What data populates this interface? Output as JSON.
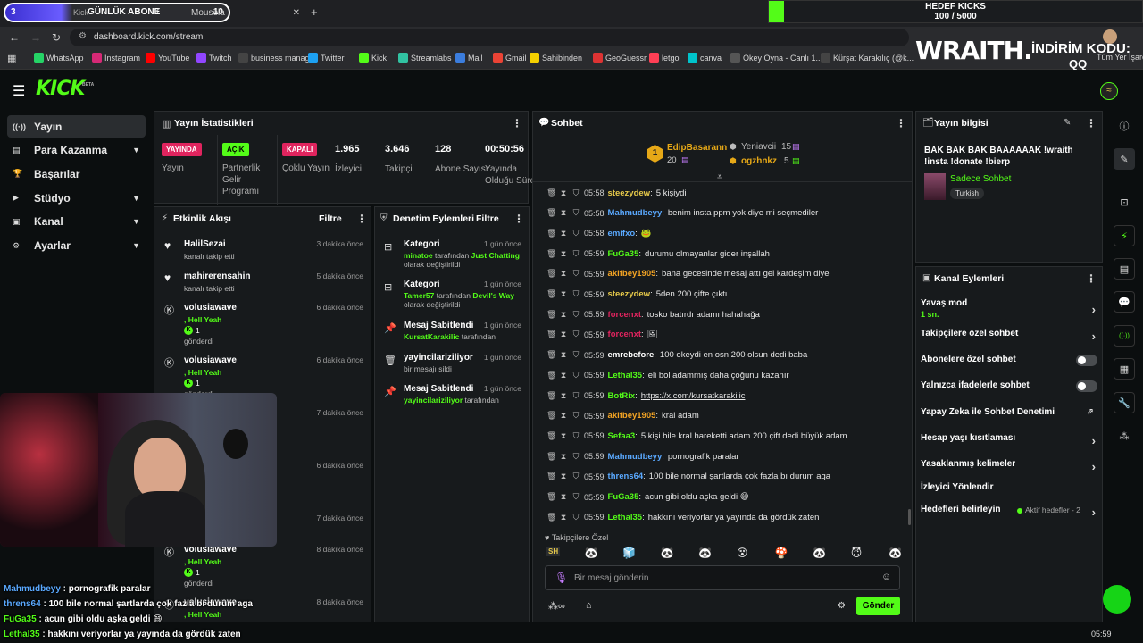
{
  "browser": {
    "tab1_counter": "3",
    "tab1_label": "GÜNLÜK ABONE",
    "tab1_prefix": "Kick",
    "tab1_count": "10",
    "tab2_label": "Mousela",
    "address": "dashboard.kick.com/stream",
    "bookmarks": [
      "WhatsApp",
      "Instagram",
      "YouTube",
      "Twitch",
      "business manager",
      "Twitter",
      "Kick",
      "Streamlabs",
      "Mail",
      "Gmail",
      "Sahibinden",
      "GeoGuessr",
      "letgo",
      "canva",
      "Okey Oyna - Canlı 1...",
      "Kürşat Karakılıç (@k..."
    ],
    "bookmarks_right": "Tüm Yer İşaretleri"
  },
  "overlay": {
    "goal_title": "HEDEF KICKS",
    "goal_value": "100 / 5000",
    "goal_progress": 0.02,
    "brand": "WRAITH.",
    "discount_label": "İNDİRİM KODU:",
    "discount_code": "QQ",
    "clock": "05:59",
    "chat_overlay": [
      {
        "user": "Mahmudbeyy",
        "text": "pornografik paralar",
        "color": "#5aa9ff"
      },
      {
        "user": "threns64",
        "text": "100 bile normal şartlarda çok fazla bı durum aga",
        "color": "#5aa9ff"
      },
      {
        "user": "FuGa35",
        "text": "acun gibi oldu aşka geldi 😄",
        "color": "#53fc18"
      },
      {
        "user": "Lethal35",
        "text": "hakkını veriyorlar ya yayında da gördük zaten",
        "color": "#53fc18"
      }
    ]
  },
  "nav": {
    "logo": "KICK",
    "beta": "BETA",
    "items": [
      {
        "label": "Yayın",
        "icon": "broadcast-icon",
        "active": true
      },
      {
        "label": "Para Kazanma",
        "icon": "money-icon",
        "chevron": true
      },
      {
        "label": "Başarılar",
        "icon": "trophy-icon"
      },
      {
        "label": "Stüdyo",
        "icon": "studio-icon",
        "chevron": true
      },
      {
        "label": "Kanal",
        "icon": "channel-icon",
        "chevron": true
      },
      {
        "label": "Ayarlar",
        "icon": "gear-icon",
        "chevron": true
      }
    ]
  },
  "stats": {
    "title": "Yayın İstatistikleri",
    "items": [
      {
        "badge": "YAYINDA",
        "badge_color": "#e0245e",
        "label": "Yayın"
      },
      {
        "badge": "AÇIK",
        "badge_color": "#53fc18",
        "label": "Partnerlik Gelir Programı"
      },
      {
        "badge": "KAPALI",
        "badge_color": "#e0245e",
        "label": "Çoklu Yayın"
      },
      {
        "value": "1.965",
        "label": "İzleyici"
      },
      {
        "value": "3.646",
        "label": "Takipçi"
      },
      {
        "value": "128",
        "label": "Abone Sayısı"
      },
      {
        "value": "00:50:56",
        "label": "Yayında Olduğu Süre"
      }
    ]
  },
  "activity": {
    "title": "Etkinlik Akışı",
    "filter": "Filtre",
    "items": [
      {
        "name": "HalilSezai",
        "sub": "kanalı takip etti",
        "time": "3 dakika önce",
        "icon": "heart-icon"
      },
      {
        "name": "mahirerensahin",
        "sub": "kanalı takip etti",
        "time": "5 dakika önce",
        "icon": "heart-icon"
      },
      {
        "name": "volusiawave",
        "sub": ", Hell Yeah",
        "count": "1",
        "sub2": "gönderdi",
        "time": "6 dakika önce",
        "icon": "kick-coin-icon"
      },
      {
        "name": "volusiawave",
        "sub": ", Hell Yeah",
        "count": "1",
        "sub2": "gönderdi",
        "time": "6 dakika önce",
        "icon": "kick-coin-icon"
      },
      {
        "time": "7 dakika önce"
      },
      {
        "time": "6 dakika önce"
      },
      {
        "time": "7 dakika önce"
      },
      {
        "name": "volusiawave",
        "sub": ", Hell Yeah",
        "count": "1",
        "sub2": "gönderdi",
        "time": "8 dakika önce",
        "icon": "kick-coin-icon"
      },
      {
        "name": "volusiawave",
        "sub": ", Hell Yeah",
        "time": "8 dakika önce",
        "icon": "kick-coin-icon"
      }
    ]
  },
  "moderation": {
    "title": "Denetim Eylemleri",
    "filter": "Filtre",
    "items": [
      {
        "title": "Kategori",
        "time": "1 gün önce",
        "user": "minatoe",
        "mid": "tarafından",
        "target": "Just Chatting",
        "tail": "olarak değiştirildi",
        "icon": "category-icon"
      },
      {
        "title": "Kategori",
        "time": "1 gün önce",
        "user": "Tamer57",
        "mid": "tarafından",
        "target": "Devil's Way",
        "tail": "olarak değiştirildi",
        "icon": "category-icon"
      },
      {
        "title": "Mesaj Sabitlendi",
        "time": "1 gün önce",
        "user": "KursatKarakilic",
        "mid": "tarafından",
        "icon": "pin-icon"
      },
      {
        "title": "yayincilariziliyor",
        "time": "1 gün önce",
        "sub": "bir mesajı sildi",
        "icon": "trash-icon"
      },
      {
        "title": "Mesaj Sabitlendi",
        "time": "1 gün önce",
        "user": "yayincilariziliyor",
        "mid": "tarafından",
        "icon": "pin-icon"
      }
    ]
  },
  "chat": {
    "title": "Sohbet",
    "leaders": [
      {
        "rank": "1",
        "name": "EdipBasarann",
        "value": "20"
      },
      {
        "name": "Yeniavcii",
        "value": "15"
      },
      {
        "name": "ogzhnkz",
        "value": "5"
      }
    ],
    "messages": [
      {
        "time": "05:58",
        "user": "steezydew",
        "color": "#e6c94a",
        "text": "5 kişiydi"
      },
      {
        "time": "05:58",
        "user": "Mahmudbeyy",
        "color": "#5aa9ff",
        "text": "benim insta ppm yok diye mi seçmediler"
      },
      {
        "time": "05:58",
        "user": "emifxo",
        "color": "#5aa9ff",
        "text": "🐸"
      },
      {
        "time": "05:59",
        "user": "FuGa35",
        "color": "#53fc18",
        "text": "durumu olmayanlar gider inşallah"
      },
      {
        "time": "05:59",
        "user": "akifbey1905",
        "color": "#f5a524",
        "text": "bana gecesinde mesaj attı gel kardeşim diye"
      },
      {
        "time": "05:59",
        "user": "steezydew",
        "color": "#e6c94a",
        "text": "5den 200 çifte çıktı"
      },
      {
        "time": "05:59",
        "user": "forcenxt",
        "color": "#e0245e",
        "text": "tosko batırdı adamı hahahağa"
      },
      {
        "time": "05:59",
        "user": "forcenxt",
        "color": "#e0245e",
        "text": "🖼"
      },
      {
        "time": "05:59",
        "user": "emrebefore",
        "color": "#ffffff",
        "text": "100 okeydi en osn 200 olsun dedi baba"
      },
      {
        "time": "05:59",
        "user": "Lethal35",
        "color": "#53fc18",
        "text": "eli bol adammış daha çoğunu kazanır"
      },
      {
        "time": "05:59",
        "user": "BotRix",
        "color": "#53fc18",
        "text": "https://x.com/kursatkarakilic"
      },
      {
        "time": "05:59",
        "user": "akifbey1905",
        "color": "#f5a524",
        "text": "kral adam"
      },
      {
        "time": "05:59",
        "user": "Sefaa3",
        "color": "#53fc18",
        "text": "5 kişi bile kral hareketti adam 200 çift dedi büyük adam"
      },
      {
        "time": "05:59",
        "user": "Mahmudbeyy",
        "color": "#5aa9ff",
        "text": "pornografik paralar"
      },
      {
        "time": "05:59",
        "user": "threns64",
        "color": "#5aa9ff",
        "text": "100 bile normal şartlarda çok fazla bı durum aga"
      },
      {
        "time": "05:59",
        "user": "FuGa35",
        "color": "#53fc18",
        "text": "acun gibi oldu aşka geldi 😄"
      },
      {
        "time": "05:59",
        "user": "Lethal35",
        "color": "#53fc18",
        "text": "hakkını veriyorlar ya yayında da gördük zaten"
      }
    ],
    "followers_label": "Takipçilere Özel",
    "emotes": [
      "SH",
      "🐼",
      "🧊",
      "🐼",
      "🐼",
      "😵",
      "🍄",
      "🐼",
      "😈",
      "🐼"
    ],
    "placeholder": "Bir mesaj gönderin",
    "send": "Gönder"
  },
  "stream_info": {
    "title": "Yayın bilgisi",
    "text": "BAK BAK BAK BAAAAAAK !wraith !insta !donate !bierp",
    "category": "Sadece Sohbet",
    "tag": "Turkish"
  },
  "channel_actions": {
    "title": "Kanal Eylemleri",
    "rows": [
      {
        "label": "Yavaş mod",
        "sub": "1 sn.",
        "kind": "chevron"
      },
      {
        "label": "Takipçilere özel sohbet",
        "kind": "chevron"
      },
      {
        "label": "Abonelere özel sohbet",
        "kind": "toggle"
      },
      {
        "label": "Yalnızca ifadelerle sohbet",
        "kind": "toggle"
      },
      {
        "label": "Yapay Zeka ile Sohbet Denetimi",
        "kind": "external"
      },
      {
        "label": "Hesap yaşı kısıtlaması",
        "kind": "chevron"
      },
      {
        "label": "Yasaklanmış kelimeler",
        "kind": "chevron"
      },
      {
        "label": "İzleyici Yönlendir",
        "kind": "none"
      },
      {
        "label": "Hedefleri belirleyin",
        "kind": "chevron",
        "extra": "Aktif hedefler - 2"
      }
    ]
  }
}
